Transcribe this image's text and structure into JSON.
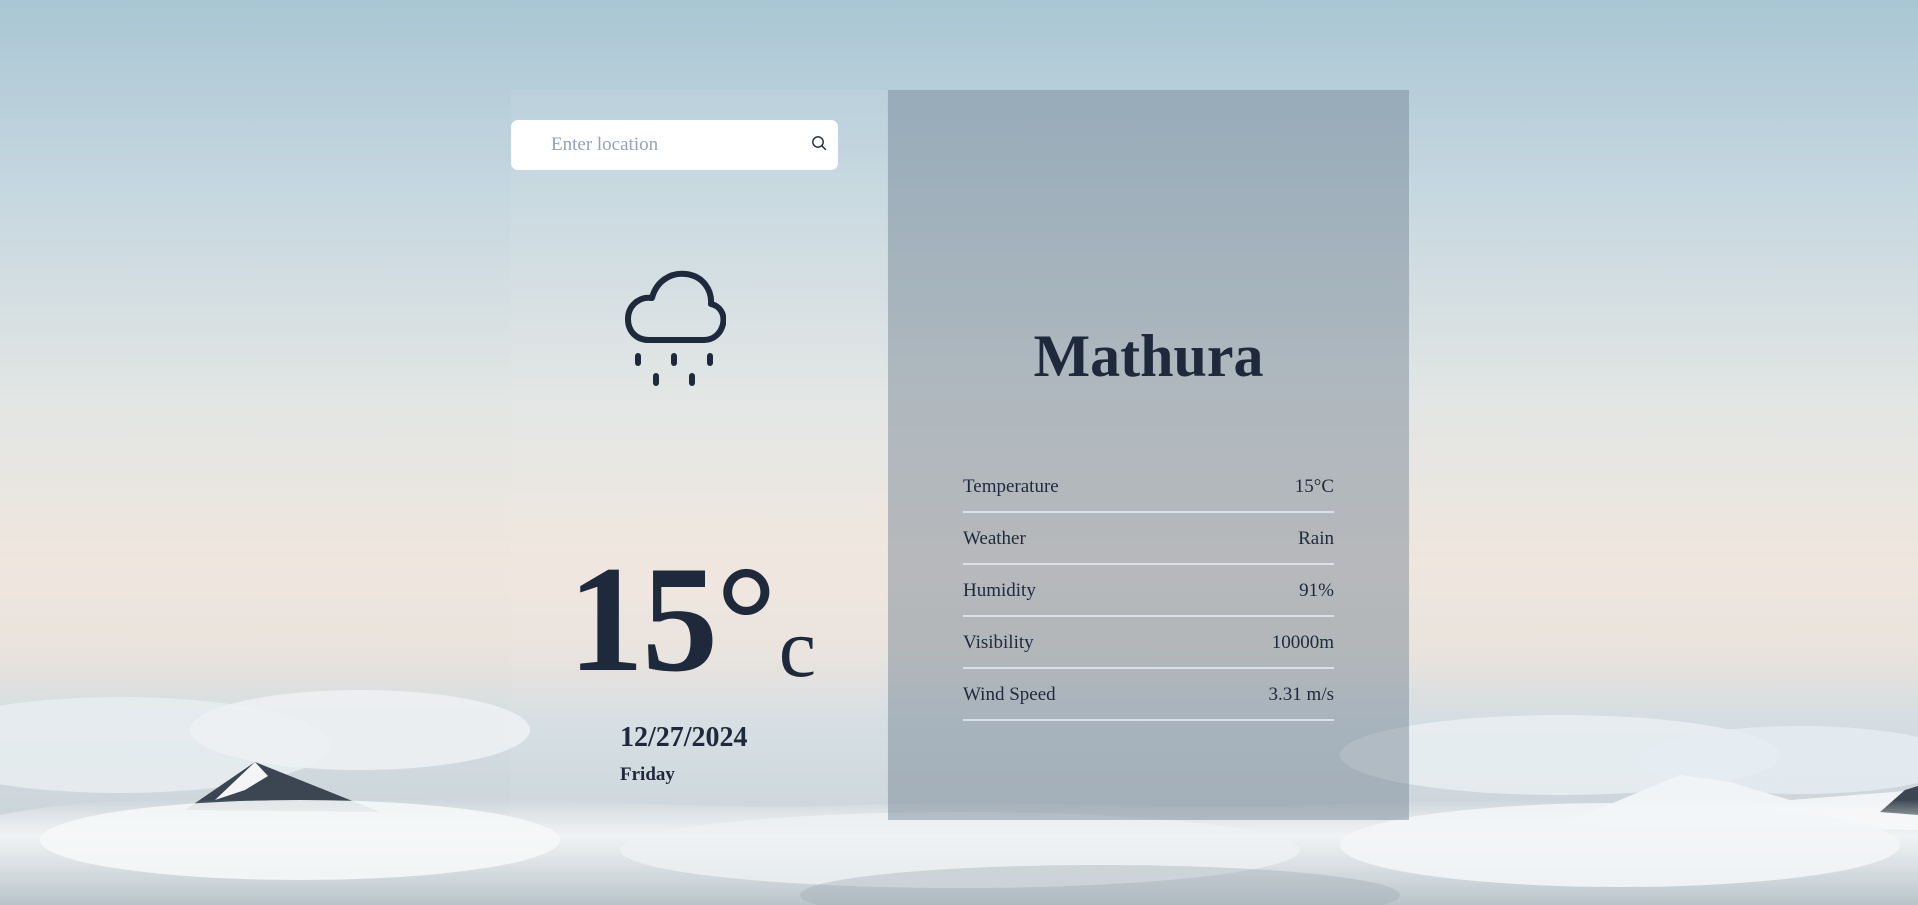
{
  "search": {
    "placeholder": "Enter location",
    "value": ""
  },
  "current": {
    "icon": "cloud-rain-icon",
    "temperature": "15°",
    "unit": "c",
    "date": "12/27/2024",
    "day": "Friday"
  },
  "details": {
    "city": "Mathura",
    "rows": [
      {
        "label": "Temperature",
        "value": "15°C"
      },
      {
        "label": "Weather",
        "value": "Rain"
      },
      {
        "label": "Humidity",
        "value": "91%"
      },
      {
        "label": "Visibility",
        "value": "10000m"
      },
      {
        "label": "Wind Speed",
        "value": "3.31 m/s"
      }
    ]
  },
  "colors": {
    "text": "#1e293b",
    "panel": "rgba(112,128,144,0.45)",
    "divider": "#e2e8f0"
  }
}
